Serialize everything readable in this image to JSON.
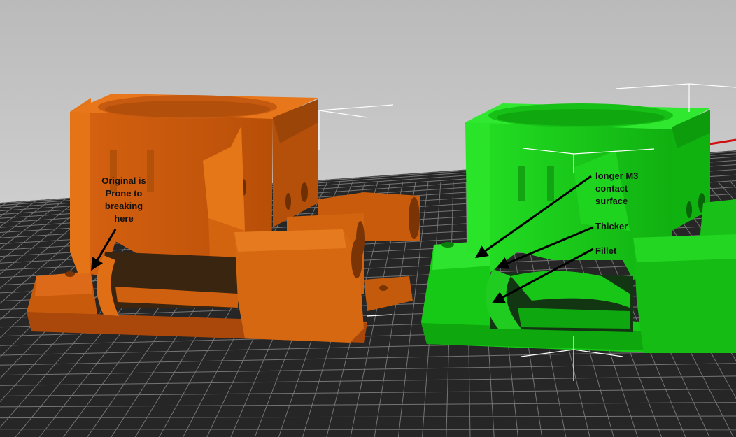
{
  "colors": {
    "background_top": "#bdbdbd",
    "background_bottom": "#e2e2e2",
    "bed": "#262626",
    "grid_line": "#9a9a9a",
    "original_part": "#d9620f",
    "modified_part": "#19d419",
    "annotation_arrow": "#000000"
  },
  "annotations": {
    "original_note_lines": [
      "Original is",
      "Prone to",
      "breaking",
      "here"
    ],
    "longer_contact_lines": [
      "longer M3",
      "contact",
      "surface"
    ],
    "thicker": "Thicker",
    "fillet": "Fillet"
  }
}
